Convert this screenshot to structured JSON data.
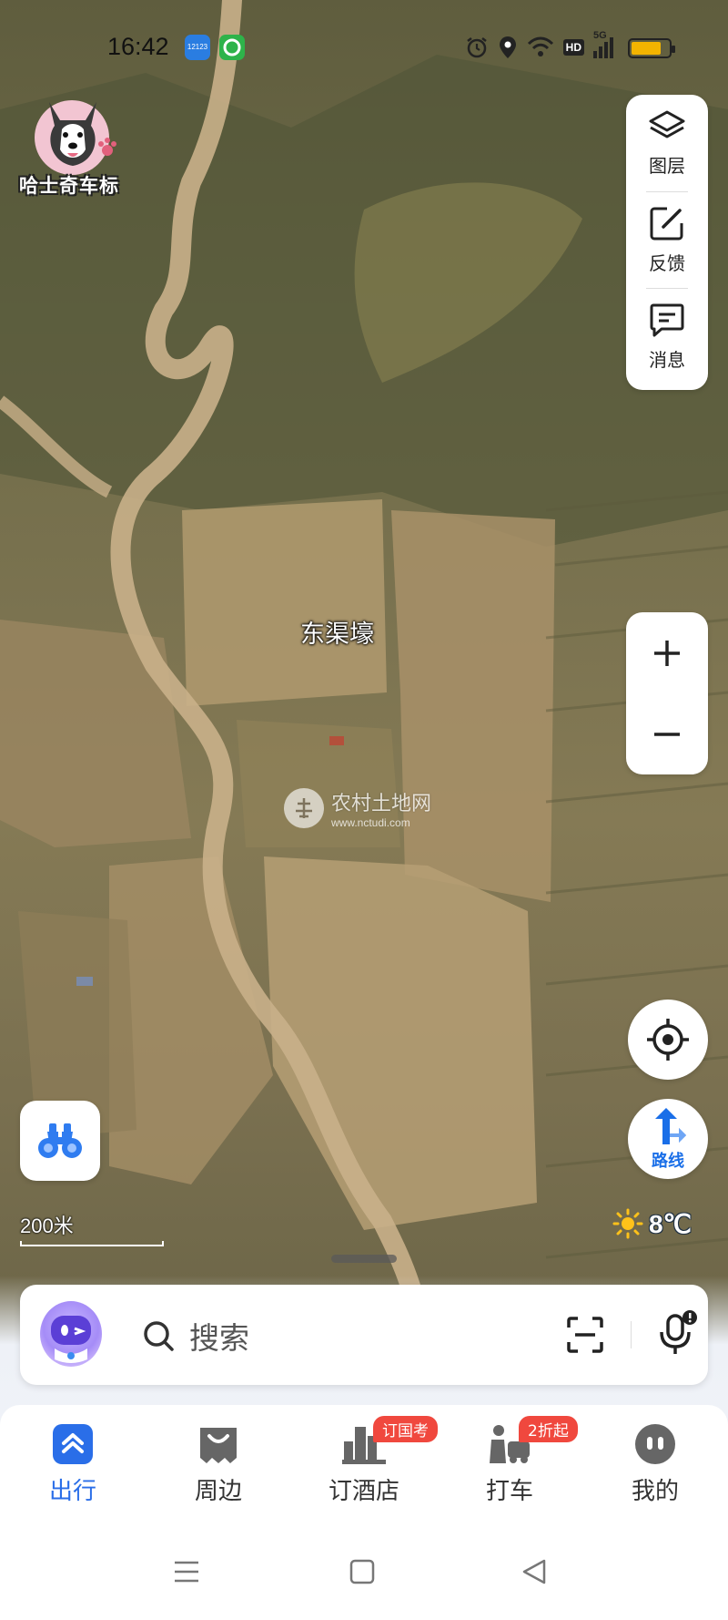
{
  "status_bar": {
    "time": "16:42",
    "app_icons": [
      "12123-app-icon",
      "green-app-icon"
    ],
    "app_icon_text": "12123",
    "icons": [
      "alarm-icon",
      "location-pin-icon",
      "wifi-icon",
      "hd-icon",
      "signal-5g-icon",
      "battery-icon"
    ],
    "hd_label": "HD",
    "network_label": "5G",
    "battery_level": 0.8,
    "battery_color": "#f3b400"
  },
  "logo": {
    "label": "哈士奇车标"
  },
  "map_tools": {
    "layers_label": "图层",
    "feedback_label": "反馈",
    "messages_label": "消息"
  },
  "map": {
    "place_label": "东渠壕",
    "watermark_title": "农村土地网",
    "watermark_url": "www.nctudi.com",
    "scale_label": "200米",
    "weather_temp": "8℃",
    "weather_icon": "sun-icon"
  },
  "zoom": {
    "in_icon": "plus-icon",
    "out_icon": "minus-icon"
  },
  "route_button": {
    "label": "路线"
  },
  "search": {
    "placeholder": "搜索"
  },
  "tabs": [
    {
      "label": "出行",
      "icon": "travel-icon",
      "active": true
    },
    {
      "label": "周边",
      "icon": "nearby-icon",
      "active": false
    },
    {
      "label": "订酒店",
      "icon": "hotel-icon",
      "badge": "订国考",
      "active": false
    },
    {
      "label": "打车",
      "icon": "taxi-icon",
      "badge": "2折起",
      "active": false
    },
    {
      "label": "我的",
      "icon": "profile-icon",
      "active": false
    }
  ],
  "colors": {
    "accent": "#2a6ee8",
    "badge": "#f0483e"
  }
}
